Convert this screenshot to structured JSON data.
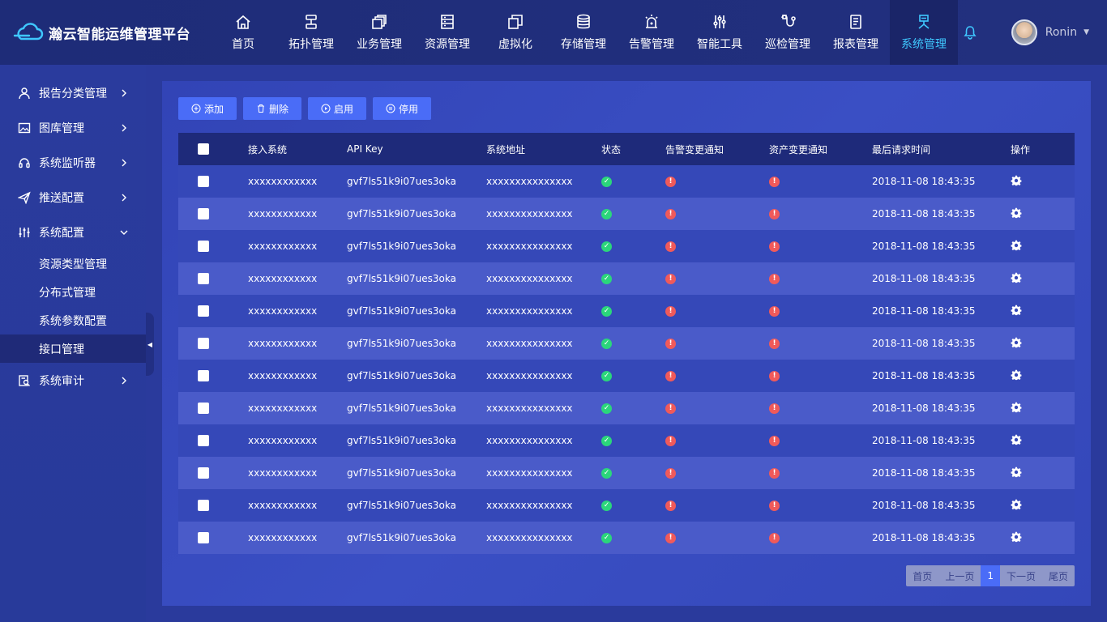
{
  "header": {
    "brand": "瀚云智能运维管理平台",
    "nav": [
      {
        "label": "首页",
        "icon": "home-icon"
      },
      {
        "label": "拓扑管理",
        "icon": "topology-icon"
      },
      {
        "label": "业务管理",
        "icon": "business-icon"
      },
      {
        "label": "资源管理",
        "icon": "resource-icon"
      },
      {
        "label": "虚拟化",
        "icon": "virtualization-icon"
      },
      {
        "label": "存储管理",
        "icon": "storage-icon"
      },
      {
        "label": "告警管理",
        "icon": "alarm-icon"
      },
      {
        "label": "智能工具",
        "icon": "tools-icon"
      },
      {
        "label": "巡检管理",
        "icon": "inspection-icon"
      },
      {
        "label": "报表管理",
        "icon": "report-icon"
      },
      {
        "label": "系统管理",
        "icon": "system-icon",
        "active": true
      }
    ],
    "user": "Ronin",
    "accent": "#3fc8ff"
  },
  "sidebar": {
    "items": [
      {
        "label": "报告分类管理",
        "icon": "user-icon"
      },
      {
        "label": "图库管理",
        "icon": "image-icon"
      },
      {
        "label": "系统监听器",
        "icon": "headset-icon"
      },
      {
        "label": "推送配置",
        "icon": "send-icon"
      },
      {
        "label": "系统配置",
        "icon": "sliders-icon",
        "expanded": true
      }
    ],
    "sub_items": [
      "资源类型管理",
      "分布式管理",
      "系统参数配置",
      "接口管理"
    ],
    "active_sub": "接口管理",
    "last_item": {
      "label": "系统审计",
      "icon": "audit-icon"
    }
  },
  "toolbar": {
    "add": "添加",
    "delete": "删除",
    "enable": "启用",
    "disable": "停用"
  },
  "table": {
    "columns": [
      "接入系统",
      "API Key",
      "系统地址",
      "状态",
      "告警变更通知",
      "资产变更通知",
      "最后请求时间",
      "操作"
    ],
    "rows": [
      {
        "system": "xxxxxxxxxxxx",
        "api_key": "gvf7ls51k9i07ues3oka",
        "address": "xxxxxxxxxxxxxxx",
        "time": "2018-11-08 18:43:35"
      },
      {
        "system": "xxxxxxxxxxxx",
        "api_key": "gvf7ls51k9i07ues3oka",
        "address": "xxxxxxxxxxxxxxx",
        "time": "2018-11-08 18:43:35"
      },
      {
        "system": "xxxxxxxxxxxx",
        "api_key": "gvf7ls51k9i07ues3oka",
        "address": "xxxxxxxxxxxxxxx",
        "time": "2018-11-08 18:43:35"
      },
      {
        "system": "xxxxxxxxxxxx",
        "api_key": "gvf7ls51k9i07ues3oka",
        "address": "xxxxxxxxxxxxxxx",
        "time": "2018-11-08 18:43:35"
      },
      {
        "system": "xxxxxxxxxxxx",
        "api_key": "gvf7ls51k9i07ues3oka",
        "address": "xxxxxxxxxxxxxxx",
        "time": "2018-11-08 18:43:35"
      },
      {
        "system": "xxxxxxxxxxxx",
        "api_key": "gvf7ls51k9i07ues3oka",
        "address": "xxxxxxxxxxxxxxx",
        "time": "2018-11-08 18:43:35"
      },
      {
        "system": "xxxxxxxxxxxx",
        "api_key": "gvf7ls51k9i07ues3oka",
        "address": "xxxxxxxxxxxxxxx",
        "time": "2018-11-08 18:43:35"
      },
      {
        "system": "xxxxxxxxxxxx",
        "api_key": "gvf7ls51k9i07ues3oka",
        "address": "xxxxxxxxxxxxxxx",
        "time": "2018-11-08 18:43:35"
      },
      {
        "system": "xxxxxxxxxxxx",
        "api_key": "gvf7ls51k9i07ues3oka",
        "address": "xxxxxxxxxxxxxxx",
        "time": "2018-11-08 18:43:35"
      },
      {
        "system": "xxxxxxxxxxxx",
        "api_key": "gvf7ls51k9i07ues3oka",
        "address": "xxxxxxxxxxxxxxx",
        "time": "2018-11-08 18:43:35"
      },
      {
        "system": "xxxxxxxxxxxx",
        "api_key": "gvf7ls51k9i07ues3oka",
        "address": "xxxxxxxxxxxxxxx",
        "time": "2018-11-08 18:43:35"
      },
      {
        "system": "xxxxxxxxxxxx",
        "api_key": "gvf7ls51k9i07ues3oka",
        "address": "xxxxxxxxxxxxxxx",
        "time": "2018-11-08 18:43:35"
      }
    ],
    "status_ok_color": "#2bd67b",
    "status_warn_color": "#f05a5a"
  },
  "pagination": {
    "first": "首页",
    "prev": "上一页",
    "current": "1",
    "next": "下一页",
    "last": "尾页"
  }
}
